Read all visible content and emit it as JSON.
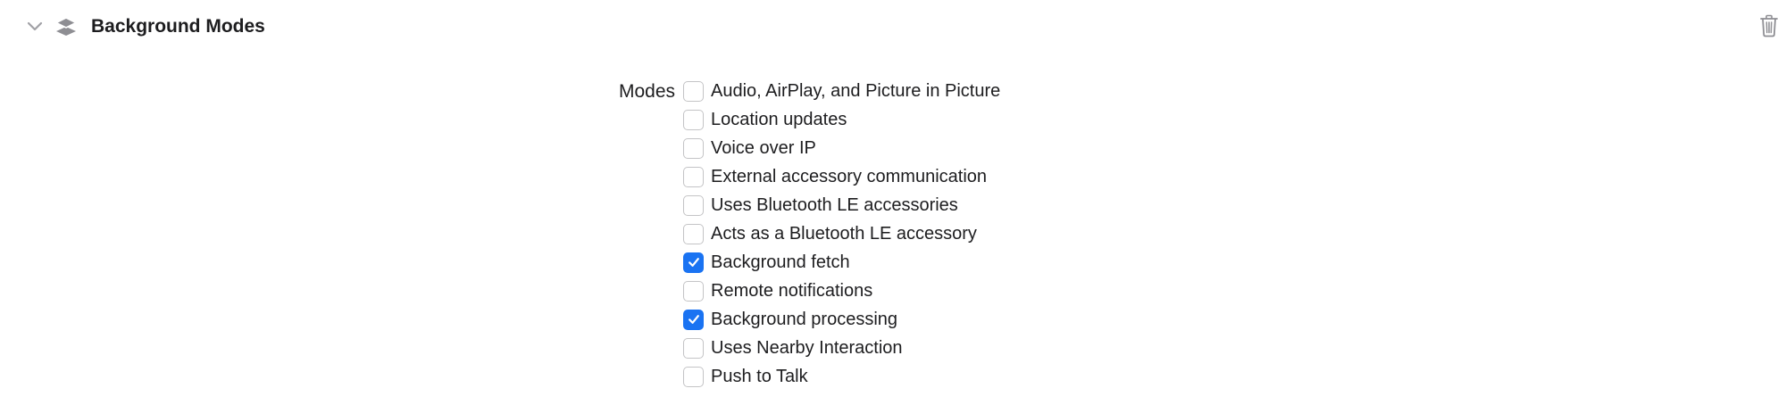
{
  "section": {
    "title": "Background Modes",
    "disclosure_icon": "chevron-down-icon",
    "capability_icon": "layers-icon",
    "delete_icon": "trash-icon"
  },
  "modes": {
    "label": "Modes",
    "items": [
      {
        "label": "Audio, AirPlay, and Picture in Picture",
        "checked": false
      },
      {
        "label": "Location updates",
        "checked": false
      },
      {
        "label": "Voice over IP",
        "checked": false
      },
      {
        "label": "External accessory communication",
        "checked": false
      },
      {
        "label": "Uses Bluetooth LE accessories",
        "checked": false
      },
      {
        "label": "Acts as a Bluetooth LE accessory",
        "checked": false
      },
      {
        "label": "Background fetch",
        "checked": true
      },
      {
        "label": "Remote notifications",
        "checked": false
      },
      {
        "label": "Background processing",
        "checked": true
      },
      {
        "label": "Uses Nearby Interaction",
        "checked": false
      },
      {
        "label": "Push to Talk",
        "checked": false
      }
    ]
  },
  "colors": {
    "accent": "#1a73f2",
    "text": "#1d1d1f",
    "icon": "#8e8e93",
    "checkbox_border": "#c4c4c6"
  }
}
